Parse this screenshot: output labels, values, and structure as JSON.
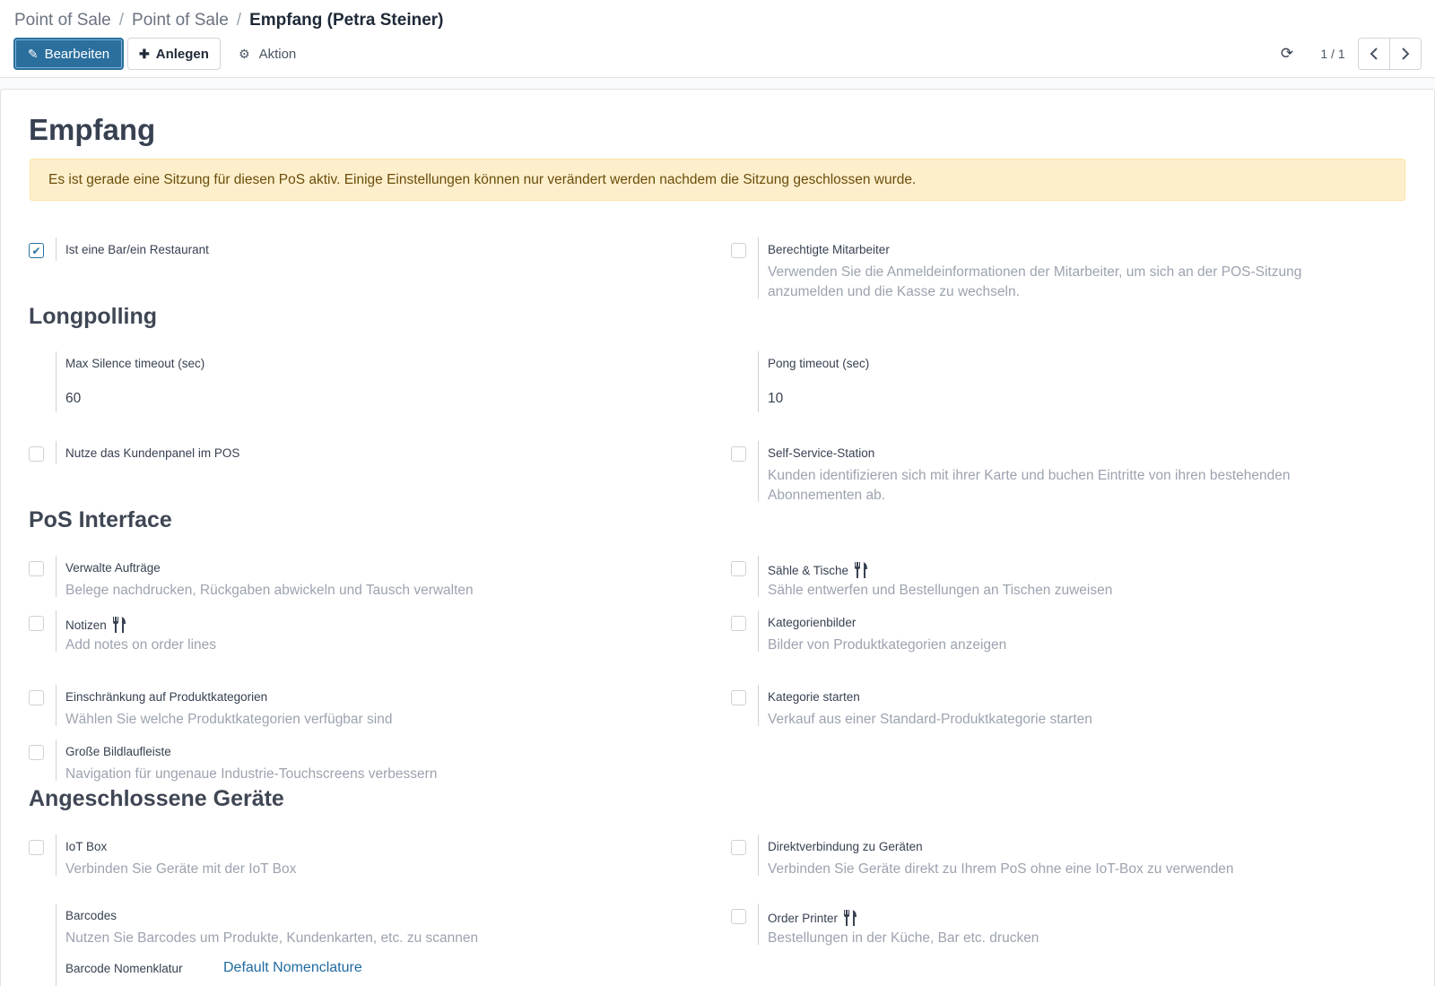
{
  "breadcrumb": {
    "items": [
      "Point of Sale",
      "Point of Sale"
    ],
    "separator": "/",
    "current": "Empfang (Petra Steiner)"
  },
  "toolbar": {
    "edit_label": "Bearbeiten",
    "create_label": "Anlegen",
    "action_label": "Aktion",
    "pager": "1 / 1"
  },
  "form": {
    "title": "Empfang",
    "alert": "Es ist gerade eine Sitzung für diesen PoS aktiv. Einige Einstellungen können nur verändert werden nachdem die Sitzung geschlossen wurde."
  },
  "sections": {
    "longpolling": "Longpolling",
    "pos_interface": "PoS Interface",
    "devices": "Angeschlossene Geräte"
  },
  "settings": {
    "bar_restaurant": {
      "label": "Ist eine Bar/ein Restaurant",
      "checked": true
    },
    "employees": {
      "label": "Berechtigte Mitarbeiter",
      "desc": "Verwenden Sie die Anmeldeinformationen der Mitarbeiter, um sich an der POS-Sitzung anzumelden und die Kasse zu wechseln.",
      "checked": false
    },
    "max_silence": {
      "label": "Max Silence timeout (sec)",
      "value": "60"
    },
    "pong_timeout": {
      "label": "Pong timeout (sec)",
      "value": "10"
    },
    "customer_panel": {
      "label": "Nutze das Kundenpanel im POS",
      "checked": false
    },
    "self_service": {
      "label": "Self-Service-Station",
      "desc": "Kunden identifizieren sich mit ihrer Karte und buchen Eintritte von ihren bestehenden Abonnementen ab.",
      "checked": false
    },
    "manage_orders": {
      "label": "Verwalte Aufträge",
      "desc": "Belege nachdrucken, Rückgaben abwickeln und Tausch verwalten",
      "checked": false
    },
    "floors_tables": {
      "label": "Sähle & Tische",
      "desc": "Sähle entwerfen und Bestellungen an Tischen zuweisen",
      "checked": false,
      "icon": "restaurant-icon"
    },
    "notes": {
      "label": "Notizen",
      "desc": "Add notes on order lines",
      "checked": false,
      "icon": "restaurant-icon"
    },
    "category_images": {
      "label": "Kategorienbilder",
      "desc": "Bilder von Produktkategorien anzeigen",
      "checked": false
    },
    "restrict_categories": {
      "label": "Einschränkung auf Produktkategorien",
      "desc": "Wählen Sie welche Produktkategorien verfügbar sind",
      "checked": false
    },
    "start_category": {
      "label": "Kategorie starten",
      "desc": "Verkauf aus einer Standard-Produktkategorie starten",
      "checked": false
    },
    "large_scrollbars": {
      "label": "Große Bildlaufleiste",
      "desc": "Navigation für ungenaue Industrie-Touchscreens verbessern",
      "checked": false
    },
    "iot_box": {
      "label": "IoT Box",
      "desc": "Verbinden Sie Geräte mit der IoT Box",
      "checked": false
    },
    "direct_devices": {
      "label": "Direktverbindung zu Geräten",
      "desc": "Verbinden Sie Geräte direkt zu Ihrem PoS ohne eine IoT-Box zu verwenden",
      "checked": false
    },
    "barcodes": {
      "label": "Barcodes",
      "desc": "Nutzen Sie Barcodes um Produkte, Kundenkarten, etc. zu scannen",
      "nomenclature_label": "Barcode Nomenklatur",
      "nomenclature_value": "Default Nomenclature"
    },
    "order_printer": {
      "label": "Order Printer",
      "desc": "Bestellungen in der Küche, Bar etc. drucken",
      "checked": false,
      "icon": "restaurant-icon"
    }
  },
  "colors": {
    "primary": "#2a6f9e",
    "alert_bg": "#fdefcc",
    "alert_text": "#6b4d0b",
    "muted_text": "#9ca3af",
    "link": "#1f6aa0"
  }
}
